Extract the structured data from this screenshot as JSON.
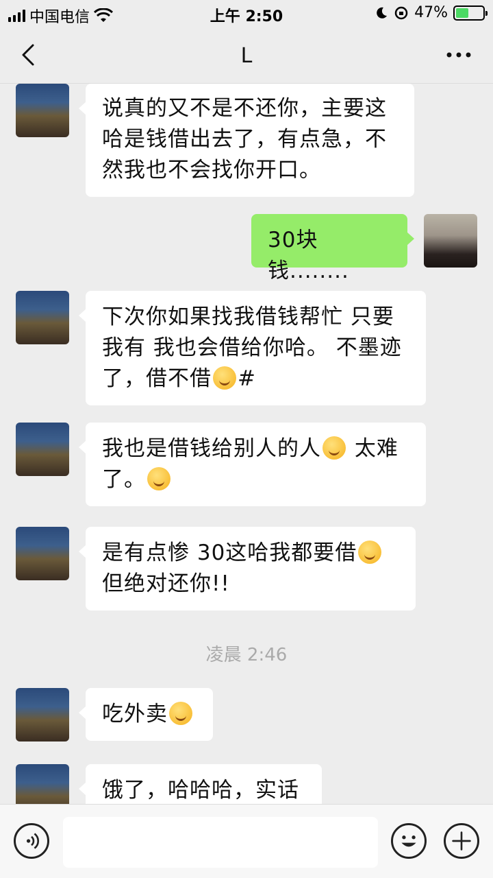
{
  "status_bar": {
    "carrier": "中国电信",
    "time": "上午 2:50",
    "battery_percent": "47%",
    "battery_level": 0.47
  },
  "nav": {
    "title": "L"
  },
  "messages": [
    {
      "side": "left",
      "text": "说真的又不是不还你，主要这哈是钱借出去了，有点急，不然我也不会找你开口。"
    },
    {
      "side": "right",
      "text": "30块钱........"
    },
    {
      "side": "left",
      "text_before": "下次你如果找我借钱帮忙 只要我有 我也会借给你哈。 不墨迹了，借不借",
      "emoji": "flushed-face",
      "text_after": "#"
    },
    {
      "side": "left",
      "text_before": "我也是借钱给别人的人",
      "emoji": "sobbing-face",
      "text_middle": " 太难了。",
      "emoji2": "flushed-face"
    },
    {
      "side": "left",
      "text_before": "是有点惨 30这哈我都要借",
      "emoji": "sobbing-face",
      "text_after": "但绝对还你!!"
    },
    {
      "side": "left",
      "text_before": "吃外卖",
      "emoji": "sobbing-face"
    },
    {
      "side": "left",
      "text": "饿了，哈哈哈，实话"
    }
  ],
  "timestamp": "凌晨 2:46",
  "icons": {
    "back": "chevron-left-icon",
    "more": "more-dots-icon",
    "voice": "voice-icon",
    "emoji": "emoji-icon",
    "add": "plus-icon"
  },
  "colors": {
    "background": "#ededed",
    "bubble_self": "#95ec69",
    "bubble_other": "#ffffff"
  }
}
